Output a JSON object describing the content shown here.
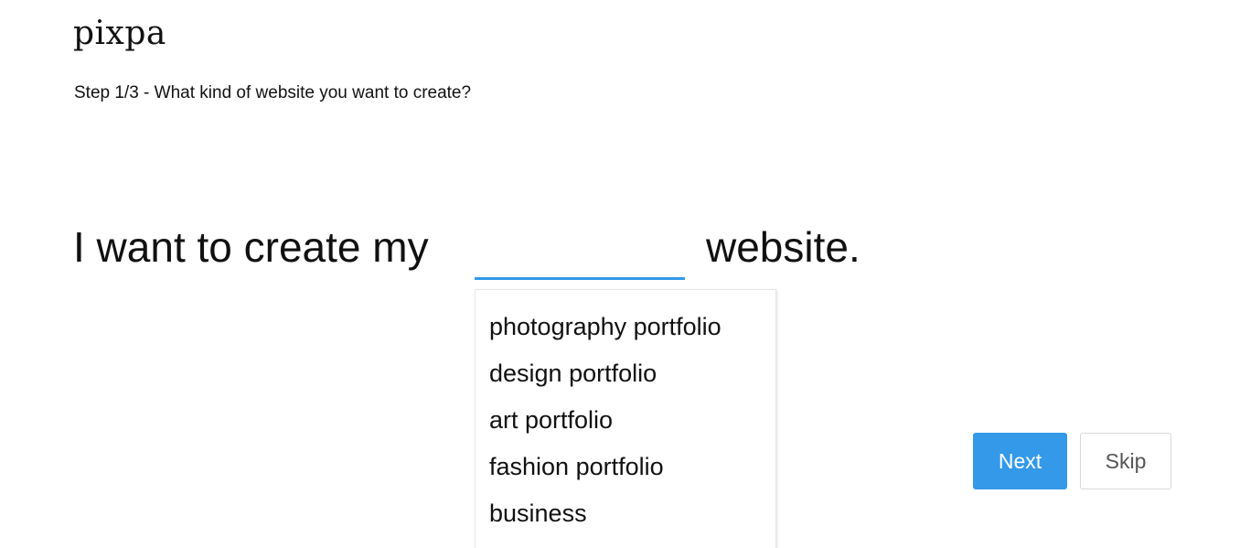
{
  "header": {
    "logo_text": "pixpa",
    "step_text": "Step 1/3 - What kind of website you want to create?"
  },
  "sentence": {
    "prefix": "I want to create my",
    "suffix": "website.",
    "input_value": "",
    "input_placeholder": "",
    "accent_color": "#3399e8"
  },
  "dropdown": {
    "options": [
      "photography portfolio",
      "design portfolio",
      "art portfolio",
      "fashion portfolio",
      "business"
    ]
  },
  "actions": {
    "next_label": "Next",
    "skip_label": "Skip",
    "next_color": "#3399e8"
  }
}
